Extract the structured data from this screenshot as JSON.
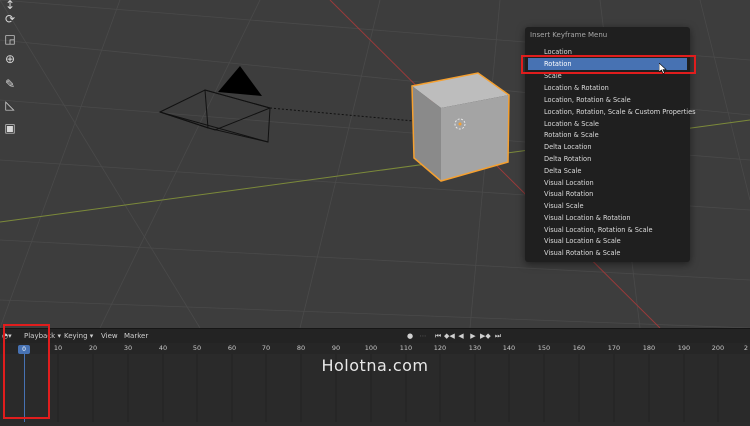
{
  "menu": {
    "title": "Insert Keyframe Menu",
    "items": [
      "Location",
      "Rotation",
      "Scale",
      "Location & Rotation",
      "Location, Rotation & Scale",
      "Location, Rotation, Scale & Custom Properties",
      "Location & Scale",
      "Rotation & Scale",
      "Delta Location",
      "Delta Rotation",
      "Delta Scale",
      "Visual Location",
      "Visual Rotation",
      "Visual Scale",
      "Visual Location & Rotation",
      "Visual Location, Rotation & Scale",
      "Visual Location & Scale",
      "Visual Rotation & Scale"
    ],
    "active_item": "Rotation"
  },
  "timeline": {
    "menus": [
      "Playback",
      "Keying",
      "View",
      "Marker"
    ],
    "current_frame": "0",
    "ticks": [
      "10",
      "20",
      "30",
      "40",
      "50",
      "60",
      "70",
      "80",
      "90",
      "100",
      "110",
      "120",
      "130",
      "140",
      "150",
      "160",
      "170",
      "180",
      "190",
      "200",
      "2"
    ]
  },
  "watermark": "Holotna.com",
  "colors": {
    "accent": "#4772b3",
    "selection_outline": "#f5a030",
    "annotation_red": "#e01d1d"
  }
}
